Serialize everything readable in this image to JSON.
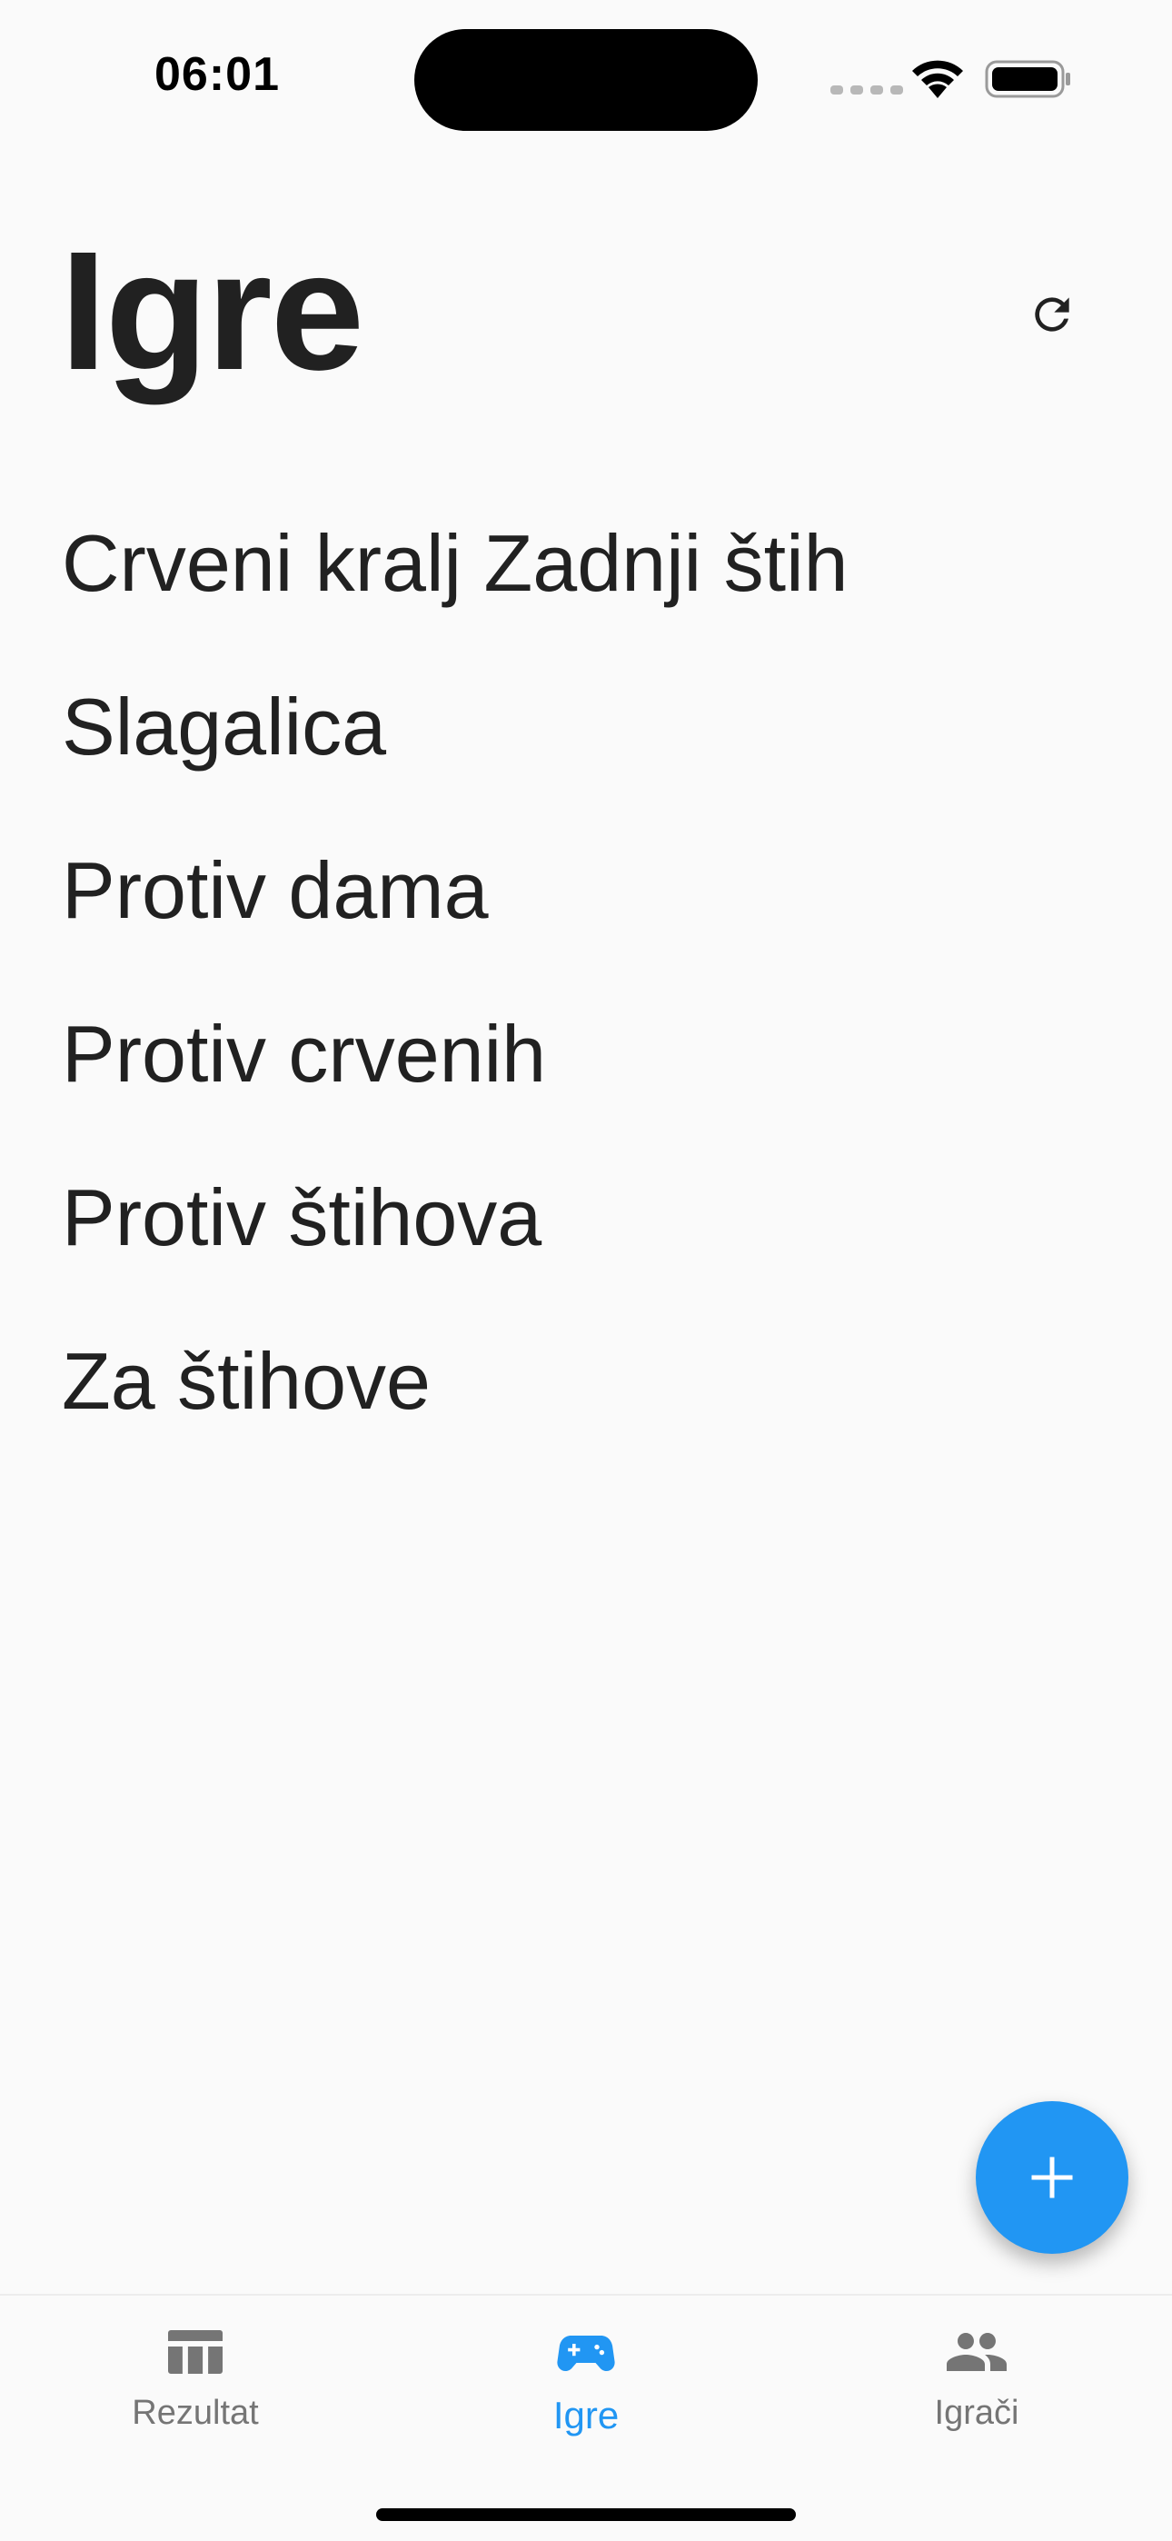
{
  "status_bar": {
    "time": "06:01"
  },
  "header": {
    "title": "Igre",
    "refresh_icon": "refresh-icon"
  },
  "games": [
    "Crveni kralj Zadnji štih",
    "Slagalica",
    "Protiv dama",
    "Protiv crvenih",
    "Protiv štihova",
    "Za štihove"
  ],
  "fab": {
    "icon": "plus-icon"
  },
  "bottom_nav": {
    "items": [
      {
        "label": "Rezultat",
        "icon": "table-icon",
        "active": false
      },
      {
        "label": "Igre",
        "icon": "gamepad-icon",
        "active": true
      },
      {
        "label": "Igrači",
        "icon": "people-icon",
        "active": false
      }
    ]
  },
  "colors": {
    "accent": "#2196f3",
    "text": "#212121",
    "inactive": "#757575",
    "background": "#fafafa"
  }
}
